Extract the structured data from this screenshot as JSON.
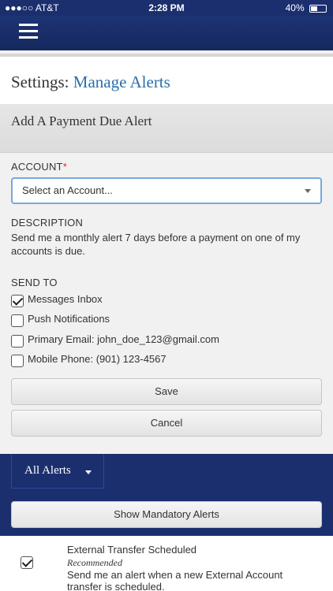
{
  "status_bar": {
    "carrier": "●●●○○ AT&T",
    "time": "2:28 PM",
    "battery": "40%"
  },
  "page": {
    "title_prefix": "Settings:",
    "title_link": "Manage Alerts"
  },
  "section": {
    "title": "Add A Payment Due Alert"
  },
  "form": {
    "account_label": "ACCOUNT",
    "account_required": "*",
    "account_placeholder": "Select an Account...",
    "description_label": "DESCRIPTION",
    "description_text": "Send me a monthly alert 7 days before a payment on one of my accounts is due.",
    "send_to_label": "SEND TO",
    "send_to": [
      {
        "label": "Messages Inbox",
        "checked": true
      },
      {
        "label": "Push Notifications",
        "checked": false
      },
      {
        "label": "Primary Email: john_doe_123@gmail.com",
        "checked": false
      },
      {
        "label": "Mobile Phone: (901) 123-4567",
        "checked": false
      }
    ],
    "save_label": "Save",
    "cancel_label": "Cancel"
  },
  "alerts": {
    "filter_label": "All Alerts",
    "mandatory_button": "Show Mandatory Alerts",
    "items": [
      {
        "name": "External Transfer Scheduled",
        "tag": "Recommended",
        "description": "Send me an alert when a new External Account transfer is scheduled.",
        "checked": true
      }
    ]
  },
  "colors": {
    "nav": "#1b2f6e",
    "link": "#2a6eab",
    "focus": "#7aa7e0"
  }
}
